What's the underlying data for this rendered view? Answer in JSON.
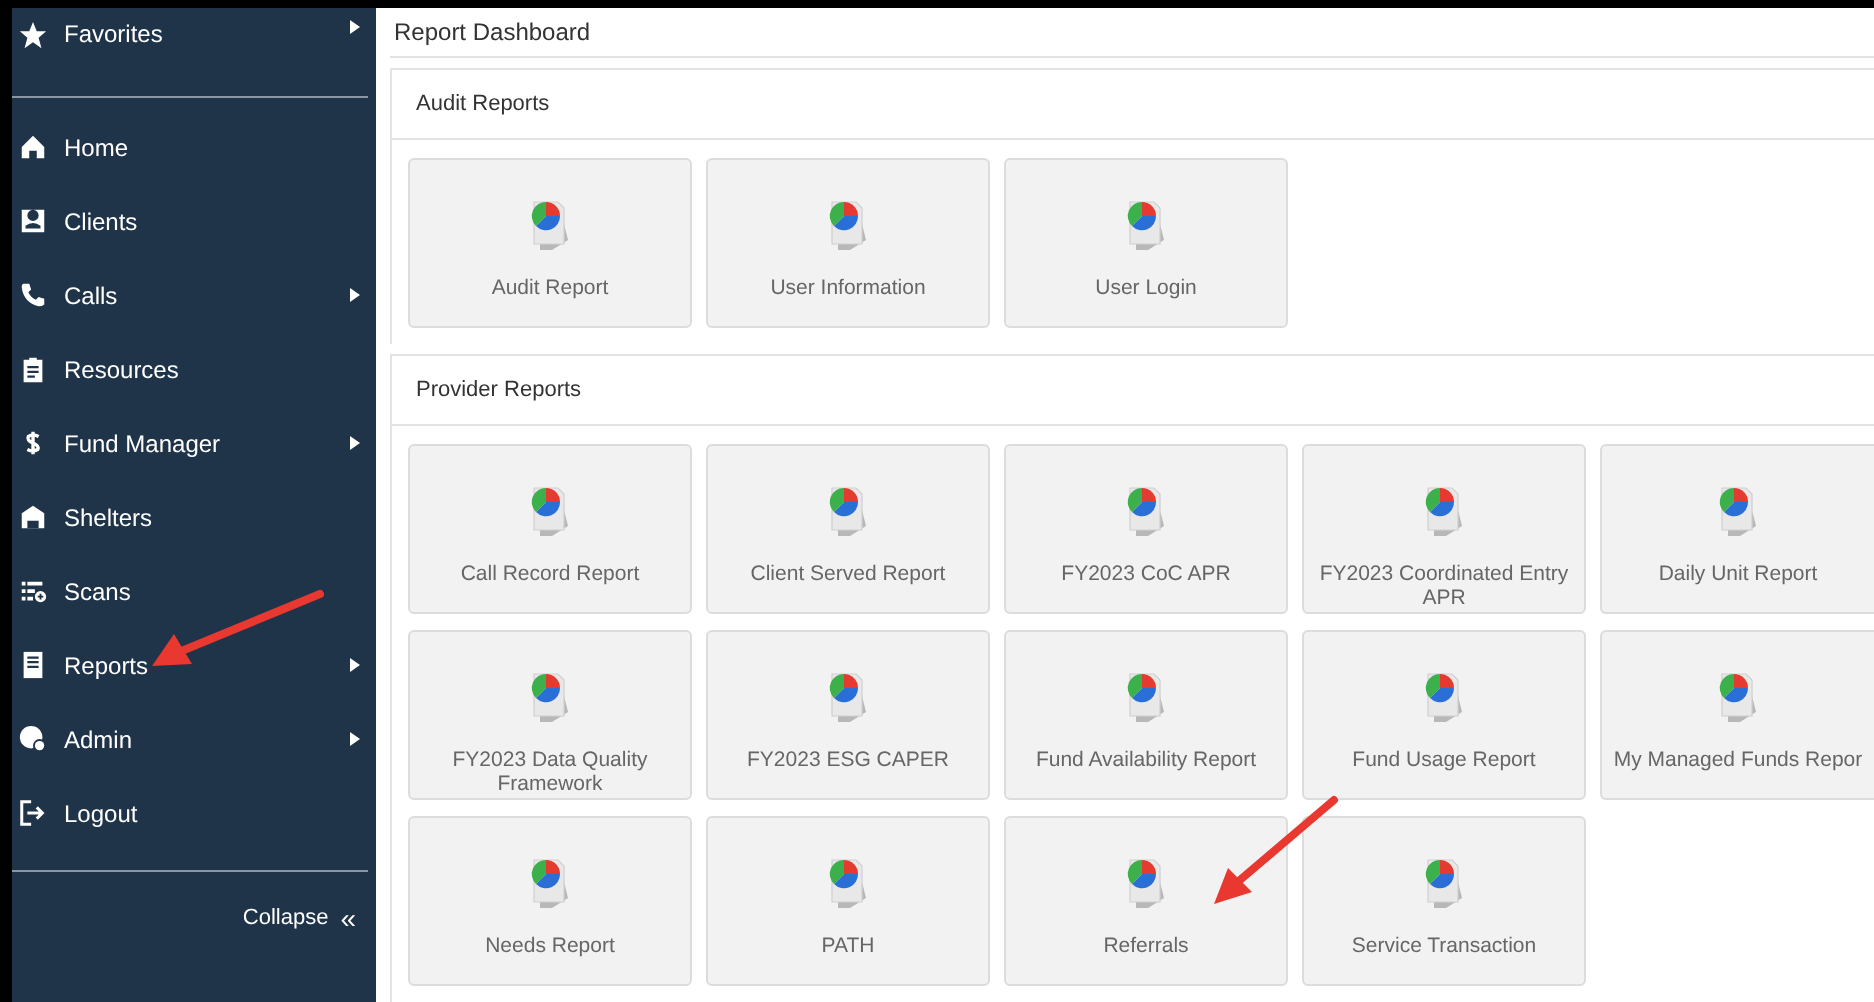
{
  "sidebar": {
    "favorites": {
      "label": "Favorites",
      "has_submenu": true
    },
    "items": [
      {
        "label": "Home",
        "has_submenu": false
      },
      {
        "label": "Clients",
        "has_submenu": false
      },
      {
        "label": "Calls",
        "has_submenu": true
      },
      {
        "label": "Resources",
        "has_submenu": false
      },
      {
        "label": "Fund Manager",
        "has_submenu": true
      },
      {
        "label": "Shelters",
        "has_submenu": false
      },
      {
        "label": "Scans",
        "has_submenu": false
      },
      {
        "label": "Reports",
        "has_submenu": true
      },
      {
        "label": "Admin",
        "has_submenu": true
      },
      {
        "label": "Logout",
        "has_submenu": false
      }
    ],
    "collapse": {
      "label": "Collapse",
      "icon_text": "«"
    }
  },
  "page_title": "Report Dashboard",
  "sections": [
    {
      "title": "Audit Reports",
      "reports": [
        "Audit Report",
        "User Information",
        "User Login"
      ]
    },
    {
      "title": "Provider Reports",
      "reports": [
        "Call Record Report",
        "Client Served Report",
        "FY2023 CoC APR",
        "FY2023 Coordinated Entry APR",
        "Daily Unit Report",
        "FY2023 Data Quality Framework",
        "FY2023 ESG CAPER",
        "Fund Availability Report",
        "Fund Usage Report",
        "My Managed Funds Repor",
        "Needs Report",
        "PATH",
        "Referrals",
        "Service Transaction"
      ]
    }
  ]
}
